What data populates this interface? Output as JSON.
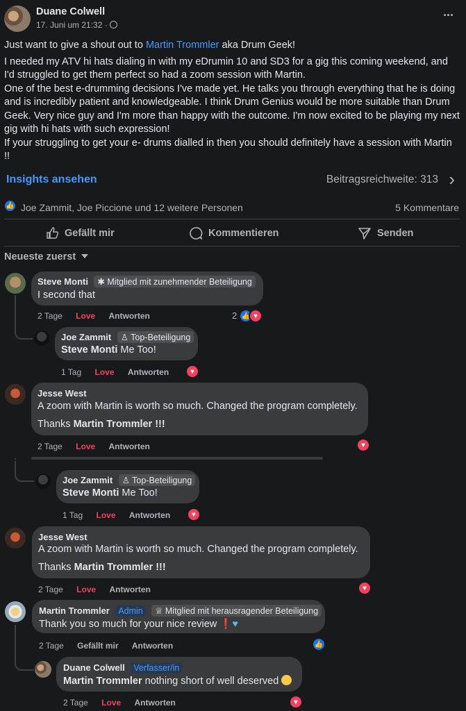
{
  "post": {
    "author": "Duane Colwell",
    "date": "17. Juni um 21:32 ·",
    "more": "···",
    "line1_a": "Just want to give a shout out to ",
    "line1_link": "Martin Trommler",
    "line1_b": " aka Drum Geek!",
    "line2": "I needed my ATV hi hats dialing in with my eDrumin 10 and SD3 for a gig this coming weekend, and I'd struggled to get them perfect so had a zoom session with Martin.",
    "line3": "One of the best e-drumming decisions I've made yet. He talks you through everything that he is doing and is incredibly patient and knowledgeable. I think Drum Genius would be more suitable than Drum Geek. Very nice guy and I'm more than happy with the outcome. I'm now excited to be playing my next gig with hi hats with such expression!",
    "line4": "If your struggling to get your e- drums dialled in then you should definitely have a session with Martin !!"
  },
  "insights": {
    "label": "Insights ansehen",
    "reach": "Beitragsreichweite: 313",
    "chevron": "›"
  },
  "reactions": {
    "names": "Joe Zammit, Joe Piccione und 12 weitere Personen",
    "comments": "5 Kommentare"
  },
  "actions": {
    "like": "Gefällt mir",
    "comment": "Kommentieren",
    "send": "Senden"
  },
  "sort": {
    "label": "Neueste zuerst"
  },
  "comments": [
    {
      "name": "Steve Monti",
      "badge": "Mitglied mit zunehmender Beteiligung",
      "text": "I second that",
      "time": "2 Tage",
      "love": "Love",
      "reply": "Antworten",
      "count": "2"
    },
    {
      "name": "Joe Zammit",
      "badge": "Top-Beteiligung",
      "mention": "Steve Monti",
      "text": " Me Too!",
      "time": "1 Tag",
      "love": "Love",
      "reply": "Antworten"
    },
    {
      "name": "Jesse West",
      "text": "A zoom with Martin is worth so much. Changed the program completely.",
      "text2a": "Thanks ",
      "text2b": "Martin Trommler",
      "text2c": " !!!",
      "time": "2 Tage",
      "love": "Love",
      "reply": "Antworten"
    },
    {
      "name": "Joe Zammit",
      "badge": "Top-Beteiligung",
      "mention": "Steve Monti",
      "text": " Me Too!",
      "time": "1 Tag",
      "love": "Love",
      "reply": "Antworten"
    },
    {
      "name": "Jesse West",
      "text": "A zoom with Martin is worth so much. Changed the program completely.",
      "text2a": "Thanks ",
      "text2b": "Martin Trommler",
      "text2c": " !!!",
      "time": "2 Tage",
      "love": "Love",
      "reply": "Antworten"
    },
    {
      "name": "Martin Trommler",
      "role": "Admin",
      "badge": "Mitglied mit herausragender Beteiligung",
      "text": "Thank you so much for your nice review",
      "time": "2 Tage",
      "like": "Gefällt mir",
      "reply": "Antworten"
    },
    {
      "name": "Duane Colwell",
      "role": "Verfasser/in",
      "mention": "Martin Trommler",
      "text": " nothing short of well deserved",
      "time": "2 Tage",
      "love": "Love",
      "reply": "Antworten"
    }
  ],
  "colors": {
    "link": "#4599ff",
    "love": "#f3425f",
    "bubble": "#3a3b3c",
    "bg": "#18191a"
  }
}
